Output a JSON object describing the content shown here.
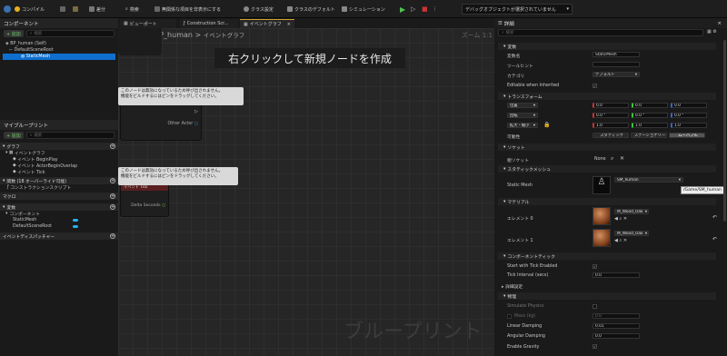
{
  "toolbar": {
    "compile": "コンパイル",
    "save": "保存",
    "diff": "差分",
    "search": "検索",
    "hide_unrelated": "無関係な項目を非表示にする",
    "class_settings": "クラス設定",
    "class_defaults": "クラスのデフォルト",
    "simulation": "シミュレーション",
    "debug_filter": "デバッグオブジェクトが選択されていません"
  },
  "components": {
    "title": "コンポーネント",
    "add": "+ 追加",
    "search_placeholder": "検索",
    "items": [
      "BP_human (Self)",
      "DefaultSceneRoot",
      "StaticMesh"
    ]
  },
  "my_blueprint": {
    "title": "マイブループリント",
    "add": "+ 追加",
    "search_placeholder": "検索",
    "graphs_header": "グラフ",
    "event_graph": "イベントグラフ",
    "events": [
      "イベント BeginPlay",
      "イベント ActorBeginOverlap",
      "イベント Tick"
    ],
    "functions_header": "関数 (18 オーバーライド可能)",
    "construction_script": "コンストラクションスクリプト",
    "macros_header": "マクロ",
    "variables_header": "変数",
    "components_cat": "コンポーネント",
    "variables": [
      "StaticMesh",
      "DefaultSceneRoot"
    ],
    "dispatchers_header": "イベントディスパッチャー"
  },
  "tabs": [
    "ビューポート",
    "Construction Scr...",
    "イベントグラフ"
  ],
  "graph": {
    "breadcrumb_root": "BP_human",
    "breadcrumb_page": "イベントグラフ",
    "zoom": "ズーム 1:1",
    "hint": "右クリックして新規ノードを作成",
    "watermark": "ブループリント",
    "disabled_tip_1": "このノードは無効になっているため呼び出されません。\n機能をビルドするにはピンをドラッグしてください。",
    "disabled_tip_2": "このノードは無効になっているため呼び出されません。\n機能をビルドするにはピンをドラッグしてください。",
    "node1_title": "イベント ActorBeginOverlap",
    "node1_pin": "Other Actor",
    "node2_title": "イベント Tick",
    "node2_pin": "Delta Seconds"
  },
  "details": {
    "title": "詳細",
    "search_placeholder": "検索",
    "variable_header": "変数",
    "var_name_label": "変数名",
    "var_name": "StaticMesh",
    "tooltip_label": "ツールヒント",
    "category_label": "カテゴリ",
    "category": "デフォルト",
    "editable_label": "Editable when Inherited",
    "transform_header": "トランスフォーム",
    "location_label": "位置",
    "rotation_label": "回転",
    "scale_label": "拡大・縮小",
    "mobility_label": "可動性",
    "location": [
      "0.0",
      "0.0",
      "0.0"
    ],
    "rotation": [
      "0.0 °",
      "0.0 °",
      "0.0 °"
    ],
    "scale": [
      "1.0",
      "1.0",
      "1.0"
    ],
    "mobility": [
      "スタティック",
      "ステーショナリー",
      "ムーバブル"
    ],
    "socket_header": "ソケット",
    "parent_socket_label": "親ソケット",
    "parent_socket": "None",
    "static_mesh_header": "スタティックメッシュ",
    "static_mesh_label": "Static Mesh",
    "static_mesh": "SM_human",
    "mesh_tooltip": "/Game/SM_human",
    "materials_header": "マテリアル",
    "element0_label": "エレメント 0",
    "element0": "M_Wood_Oak",
    "element1_label": "エレメント 1",
    "element1": "M_Wood_Oak",
    "tick_header": "コンポーネントティック",
    "tick_enabled_label": "Start with Tick Enabled",
    "tick_interval_label": "Tick Interval (secs)",
    "tick_interval": "0.0",
    "advanced_label": "詳細設定",
    "physics_header": "物理",
    "simulate_label": "Simulate Physics",
    "mass_label": "Mass (kg)",
    "mass": "0.0",
    "linear_label": "Linear Damping",
    "linear": "0.01",
    "angular_label": "Angular Damping",
    "angular": "0.0",
    "gravity_label": "Enable Gravity"
  }
}
